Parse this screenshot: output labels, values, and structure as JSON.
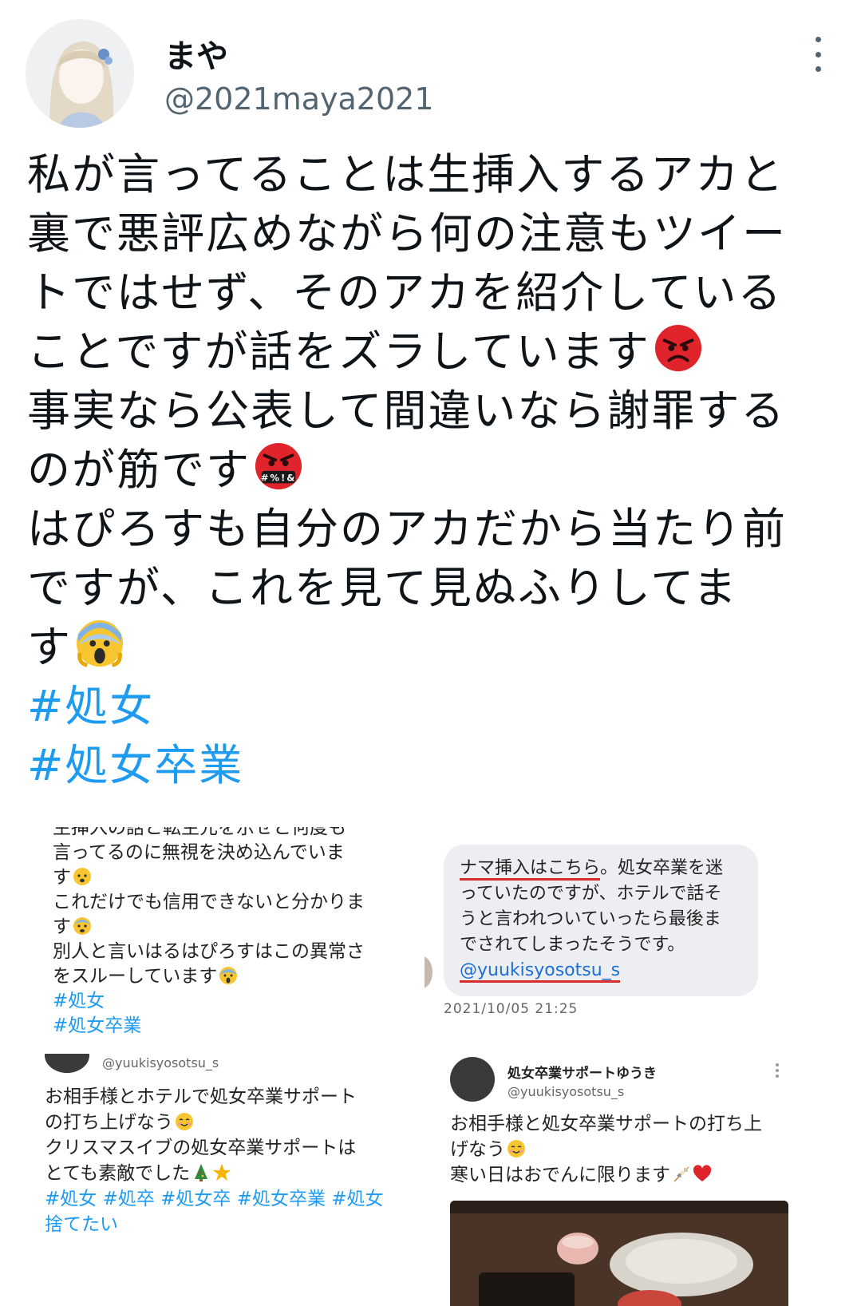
{
  "user": {
    "display_name": "まや",
    "handle": "@2021maya2021"
  },
  "tweet": {
    "lines": [
      "私が言ってることは生挿入するアカと",
      "裏で悪評広めながら何の注意もツイー",
      "トではせず、そのアカを紹介している",
      "ことですが話をズラしています",
      "事実なら公表して間違いなら謝罪する",
      "のが筋です",
      "はぴろすも自分のアカだから当たり前",
      "ですが、これを見て見ぬふりしてま",
      "す"
    ],
    "hashtags": [
      "#処女",
      "#処女卒業"
    ],
    "emoji": [
      "angry-face",
      "cursing-face",
      "screaming-face"
    ]
  },
  "media": {
    "image1": {
      "lines": [
        "生挿入の話と転生元を示せと何度も",
        "言ってるのに無視を決め込んでいま",
        "す",
        "これだけでも信用できないと分かりま",
        "す",
        "別人と言いはるはぴろすはこの異常さ",
        "をスルーしています"
      ],
      "hashtags": [
        "#処女",
        "#処女卒業"
      ]
    },
    "image2": {
      "lines": [
        "ナマ挿入はこちら",
        "。処女卒業を迷",
        "っていたのですが、ホテルで話そ",
        "うと言われついていったら最後ま",
        "でされてしまったそうです。"
      ],
      "mention": "@yuukisyosotsu_s",
      "timestamp": "2021/10/05 21:25"
    },
    "image3": {
      "handle": "@yuukisyosotsu_s",
      "lines": [
        "お相手様とホテルで処女卒業サポート",
        "の打ち上げなう",
        "クリスマスイブの処女卒業サポートは",
        "とても素敵でした"
      ],
      "hashtags_line1": "#処女 #処卒 #処女卒 #処女卒業 #処女",
      "hashtags_line2": "捨てたい"
    },
    "image4": {
      "name": "処女卒業サポートゆうき",
      "handle": "@yuukisyosotsu_s",
      "lines": [
        "お相手様と処女卒業サポートの打ち上",
        "げなう",
        "寒い日はおでんに限ります"
      ]
    }
  },
  "colors": {
    "text": "#0f1419",
    "secondary": "#536471",
    "link": "#1d9bf0",
    "underline": "#d62b2b"
  }
}
